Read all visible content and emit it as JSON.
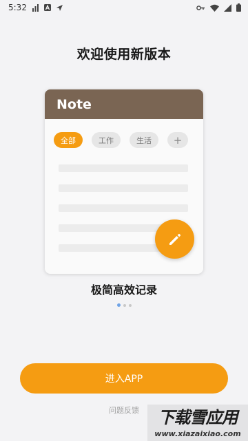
{
  "status_bar": {
    "time": "5:32"
  },
  "welcome": {
    "title": "欢迎使用新版本"
  },
  "preview_card": {
    "header_title": "Note",
    "chips": [
      "全部",
      "工作",
      "生活",
      "+"
    ]
  },
  "feature_caption": "极简高效记录",
  "pager": {
    "page_count": 3,
    "active_index": 0
  },
  "enter_button_label": "进入APP",
  "feedback_link": "问题反馈",
  "watermark": {
    "title": "下载雪应用",
    "url": "www.xiazaixiao.com"
  },
  "colors": {
    "accent": "#f59c12",
    "card_header": "#7a6553",
    "pager_active": "#6fa3e6",
    "background": "#f3f3f5"
  },
  "icons": [
    "signal-bars-icon",
    "notification-a-icon",
    "navigation-arrow-icon",
    "vpn-key-icon",
    "wifi-icon",
    "cell-signal-icon",
    "battery-icon",
    "pencil-icon"
  ]
}
